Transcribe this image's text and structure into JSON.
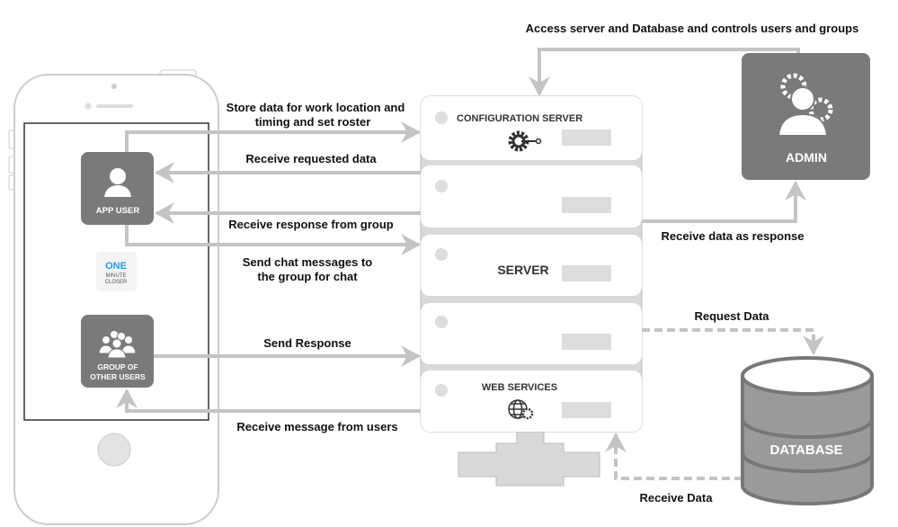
{
  "phone": {
    "app_user_label": "APP USER",
    "group_label_line1": "GROUP OF",
    "group_label_line2": "OTHER USERS",
    "logo": {
      "line1": "ONE",
      "line2": "MINUTE",
      "line3": "CLOSER",
      "color": "#1ea0e6"
    }
  },
  "server": {
    "config_label": "CONFIGURATION SERVER",
    "server_label": "SERVER",
    "web_services_label": "WEB SERVICES"
  },
  "admin": {
    "label": "ADMIN"
  },
  "database": {
    "label": "DATABASE"
  },
  "arrows": {
    "store_data_line1": "Store data for work location and",
    "store_data_line2": "timing and set roster",
    "receive_requested": "Receive requested data",
    "receive_response_group": "Receive response from group",
    "send_chat_line1": "Send chat messages to",
    "send_chat_line2": "the group for chat",
    "send_response": "Send Response",
    "receive_message": "Receive message from users",
    "access_server": "Access server and Database  and controls users and groups",
    "receive_data_response": "Receive data as response",
    "request_data": "Request Data",
    "receive_data": "Receive Data"
  },
  "colors": {
    "arrow": "#c4c4c4",
    "box": "#7a7a7a",
    "panel": "#d9d9d9"
  }
}
